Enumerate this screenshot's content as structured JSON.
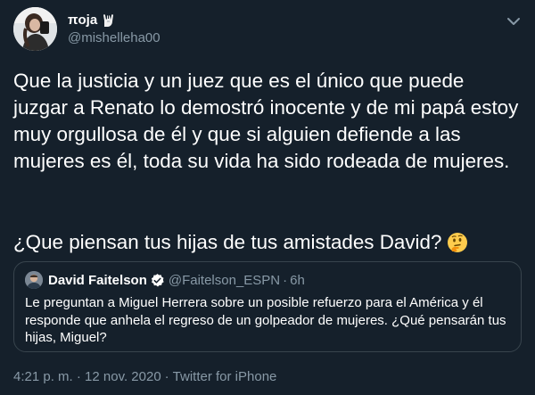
{
  "tweet": {
    "author": {
      "display_name": "πoja",
      "badge_emoji": "rock-hand-icon",
      "handle": "@mishelleha00",
      "avatar": "avatar-photo"
    },
    "text": "Que la justicia y un juez que es el único que puede juzgar a Renato lo demostró inocente y de mi papá estoy muy orgullosa de él  y que si alguien defiende a las mujeres es él, toda su vida ha sido rodeada de mujeres.",
    "question": "¿Que piensan tus hijas de tus amistades David?",
    "question_emoji": "thinking-face-icon",
    "quoted_tweet": {
      "display_name": "David Faitelson",
      "verified": true,
      "handle": "@Faitelson_ESPN",
      "dot": "·",
      "time": "6h",
      "text": "Le preguntan a Miguel Herrera sobre un posible refuerzo para el América y él responde que anhela el regreso de un golpeador de mujeres. ¿Qué pensarán tus hijas, Miguel?"
    },
    "timestamp": "4:21 p. m. · 12 nov. 2020",
    "separator": "·",
    "source": "Twitter for iPhone"
  },
  "colors": {
    "background": "#15202b",
    "text": "#ffffff",
    "secondary_text": "#8899a6",
    "border": "#38444d",
    "verified_blue": "#1da1f2"
  }
}
